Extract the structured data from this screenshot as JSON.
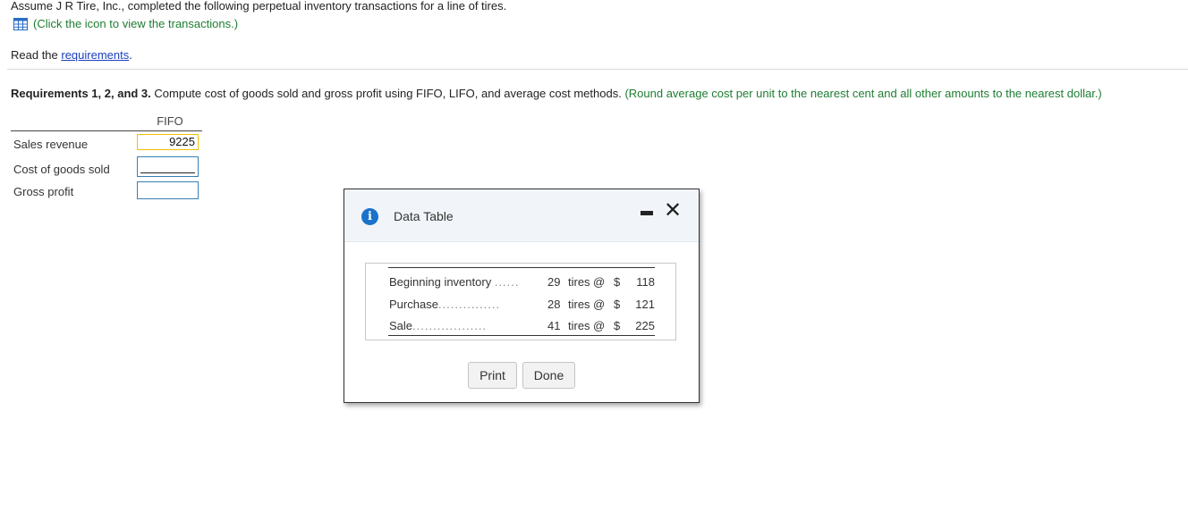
{
  "intro": {
    "text": "Assume J R Tire, Inc., completed the following perpetual inventory transactions for a line of tires.",
    "click_text": "(Click the icon to view the transactions.)"
  },
  "read": {
    "prefix": "Read the ",
    "link": "requirements",
    "suffix": "."
  },
  "requirements": {
    "bold": "Requirements 1, 2, and 3.",
    "text": " Compute cost of goods sold and gross profit using FIFO, LIFO, and average cost methods.",
    "note": " (Round average cost per unit to the nearest cent and all other amounts to the nearest dollar.)"
  },
  "form": {
    "column_header": "FIFO",
    "rows": [
      {
        "label": "Sales revenue",
        "value": "9225"
      },
      {
        "label": "Cost of goods sold",
        "value": ""
      },
      {
        "label": "Gross profit",
        "value": ""
      }
    ]
  },
  "modal": {
    "title": "Data Table",
    "info_icon": "info-icon",
    "rows": [
      {
        "name": "Beginning inventory",
        "dots": "......",
        "qty": "29",
        "unit": "tires",
        "at": "@",
        "currency": "$",
        "price": "118"
      },
      {
        "name": "Purchase",
        "dots": "...............",
        "qty": "28",
        "unit": "tires",
        "at": "@",
        "currency": "$",
        "price": "121"
      },
      {
        "name": "Sale",
        "dots": "..................",
        "qty": "41",
        "unit": "tires",
        "at": "@",
        "currency": "$",
        "price": "225"
      }
    ],
    "print_label": "Print",
    "done_label": "Done"
  },
  "colors": {
    "green_note": "#1e7d32",
    "link_blue": "#1a3fbf",
    "info_blue": "#1b72c9",
    "input_border": "#3a7fb4",
    "value_border": "#f0c000"
  }
}
